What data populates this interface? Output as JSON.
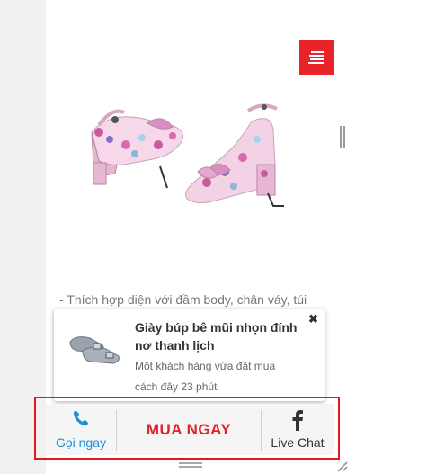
{
  "product": {
    "description": "- Thích hợp diện với đầm body, chân váy, túi",
    "image_icon": "floral-pointed-heel-shoes"
  },
  "menu": {
    "icon": "hamburger-menu-icon",
    "color": "#e8232a"
  },
  "notification": {
    "title": "Giày búp bê mũi nhọn đính nơ thanh lịch",
    "subtitle": "Một khách hàng vừa đặt mua",
    "time": "cách đây 23 phút",
    "close_label": "✖",
    "thumb_icon": "grey-ballet-flats"
  },
  "cta_bar": {
    "call_label": "Gọi ngay",
    "buy_label": "MUA NGAY",
    "chat_label": "Live Chat",
    "call_color": "#1a8fd6",
    "buy_color": "#e2222b",
    "highlight_color": "#e11a22"
  }
}
